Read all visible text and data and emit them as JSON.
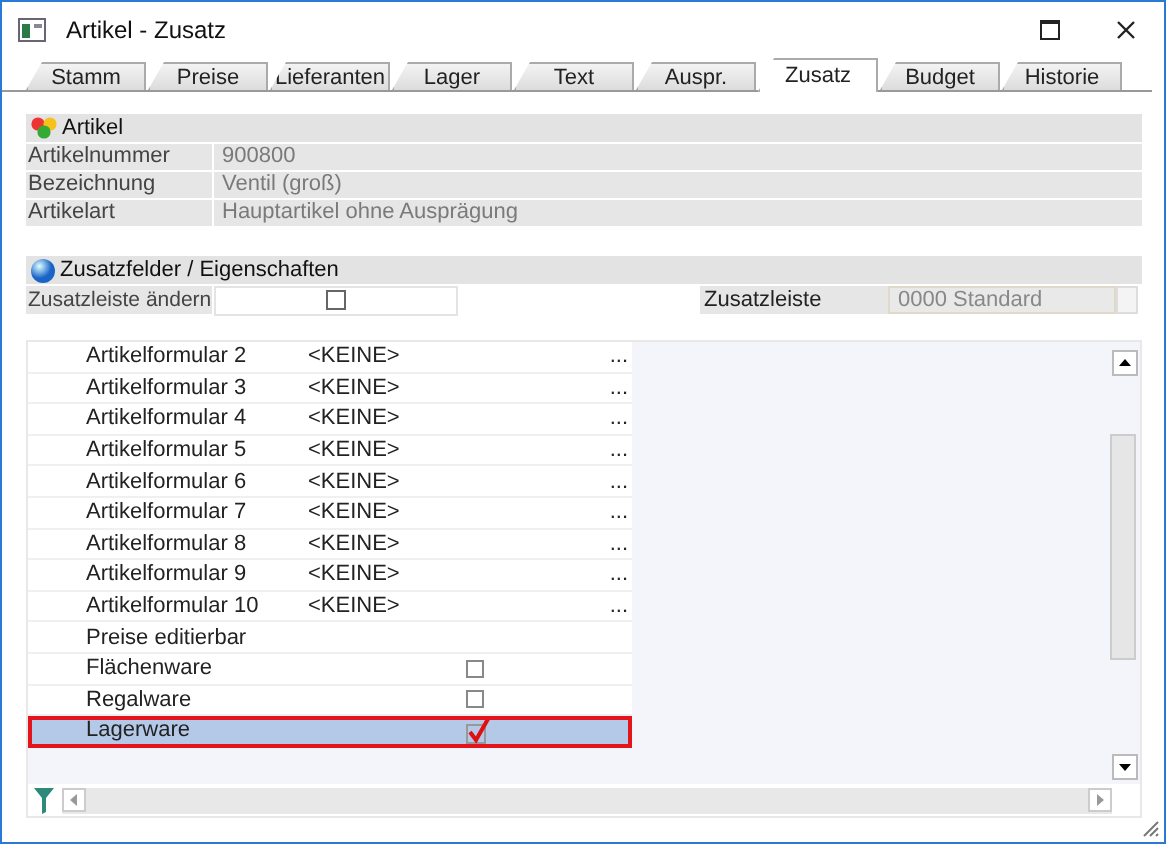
{
  "window": {
    "title": "Artikel - Zusatz"
  },
  "tabs": [
    {
      "label": "Stamm",
      "selected": false
    },
    {
      "label": "Preise",
      "selected": false
    },
    {
      "label": "Lieferanten",
      "selected": false
    },
    {
      "label": "Lager",
      "selected": false
    },
    {
      "label": "Text",
      "selected": false
    },
    {
      "label": "Auspr.",
      "selected": false
    },
    {
      "label": "Zusatz",
      "selected": true
    },
    {
      "label": "Budget",
      "selected": false
    },
    {
      "label": "Historie",
      "selected": false
    }
  ],
  "artikel": {
    "title": "Artikel",
    "fields": [
      {
        "label": "Artikelnummer",
        "value": "900800"
      },
      {
        "label": "Bezeichnung",
        "value": "Ventil (groß)"
      },
      {
        "label": "Artikelart",
        "value": "Hauptartikel ohne Ausprägung"
      }
    ]
  },
  "zusatz": {
    "title": "Zusatzfelder / Eigenschaften",
    "change_label": "Zusatzleiste ändern",
    "change_checked": false,
    "bar_label": "Zusatzleiste",
    "bar_value": "0000 Standard"
  },
  "grid": {
    "rows": [
      {
        "kind": "form",
        "name": "Artikelformular 2",
        "value": "<KEINE>",
        "button": "...",
        "selected": false
      },
      {
        "kind": "form",
        "name": "Artikelformular 3",
        "value": "<KEINE>",
        "button": "...",
        "selected": false
      },
      {
        "kind": "form",
        "name": "Artikelformular 4",
        "value": "<KEINE>",
        "button": "...",
        "selected": false
      },
      {
        "kind": "form",
        "name": "Artikelformular 5",
        "value": "<KEINE>",
        "button": "...",
        "selected": false
      },
      {
        "kind": "form",
        "name": "Artikelformular 6",
        "value": "<KEINE>",
        "button": "...",
        "selected": false
      },
      {
        "kind": "form",
        "name": "Artikelformular 7",
        "value": "<KEINE>",
        "button": "...",
        "selected": false
      },
      {
        "kind": "form",
        "name": "Artikelformular 8",
        "value": "<KEINE>",
        "button": "...",
        "selected": false
      },
      {
        "kind": "form",
        "name": "Artikelformular 9",
        "value": "<KEINE>",
        "button": "...",
        "selected": false
      },
      {
        "kind": "form",
        "name": "Artikelformular 10",
        "value": "<KEINE>",
        "button": "...",
        "selected": false
      },
      {
        "kind": "text",
        "name": "Preise editierbar",
        "selected": false
      },
      {
        "kind": "check",
        "name": "Flächenware",
        "checked": false,
        "selected": false
      },
      {
        "kind": "check",
        "name": "Regalware",
        "checked": false,
        "selected": false
      },
      {
        "kind": "check",
        "name": "Lagerware",
        "checked": true,
        "selected": true
      }
    ]
  }
}
